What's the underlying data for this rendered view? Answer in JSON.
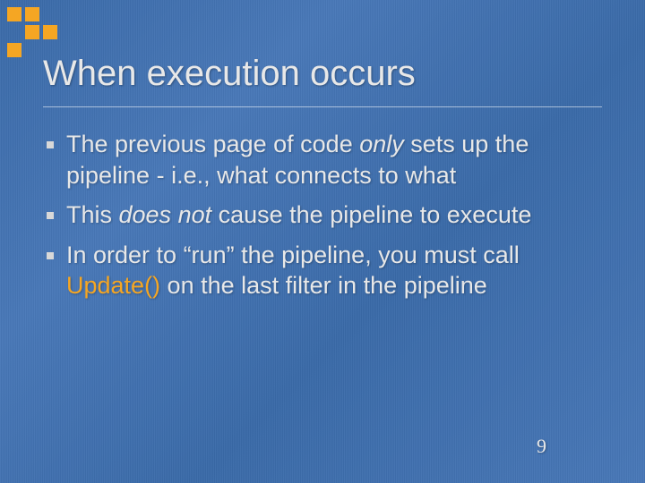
{
  "colors": {
    "accent": "#f5a623",
    "text": "#e8e8e8",
    "background": "#3e6eac"
  },
  "title": "When execution occurs",
  "bullets": [
    {
      "segments": [
        {
          "text": "The previous page of code "
        },
        {
          "text": "only",
          "style": "ital"
        },
        {
          "text": " sets up the pipeline - i.e., what connects to what"
        }
      ]
    },
    {
      "segments": [
        {
          "text": "This "
        },
        {
          "text": "does not",
          "style": "ital"
        },
        {
          "text": " cause the pipeline to execute"
        }
      ]
    },
    {
      "segments": [
        {
          "text": "In order to “run” the pipeline, you must call "
        },
        {
          "text": "Update()",
          "style": "accent"
        },
        {
          "text": " on the last filter in the pipeline"
        }
      ]
    }
  ],
  "page_number": "9",
  "decor_pattern": [
    1,
    1,
    0,
    0,
    1,
    1,
    1,
    0,
    0
  ]
}
